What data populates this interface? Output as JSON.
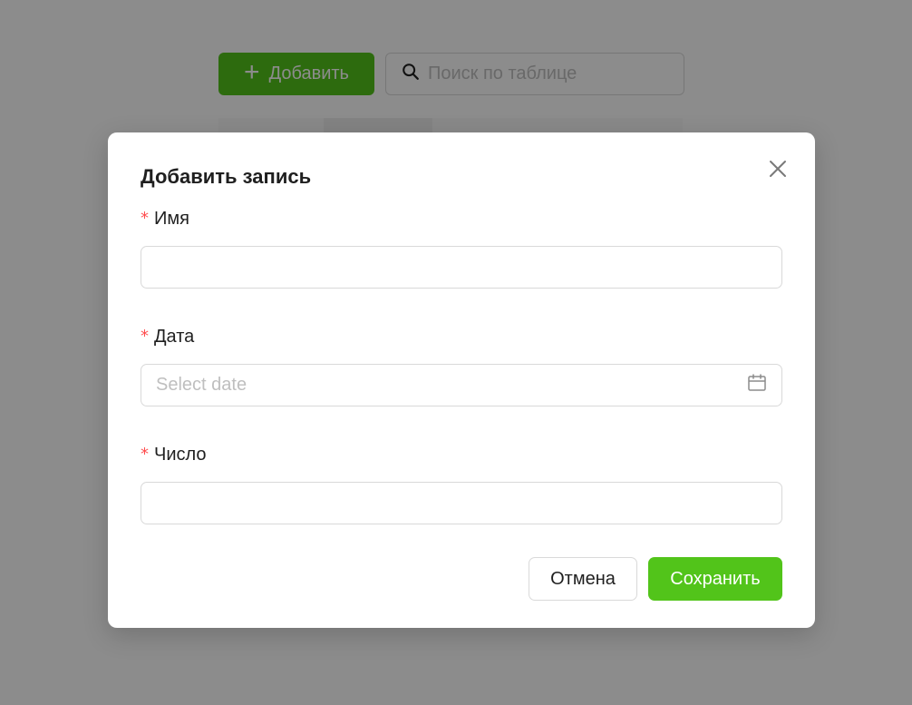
{
  "toolbar": {
    "add_label": "Добавить",
    "search_placeholder": "Поиск по таблице"
  },
  "modal": {
    "title": "Добавить запись",
    "fields": [
      {
        "label": "Имя",
        "required": true,
        "value": "",
        "placeholder": ""
      },
      {
        "label": "Дата",
        "required": true,
        "value": "",
        "placeholder": "Select date"
      },
      {
        "label": "Число",
        "required": true,
        "value": "",
        "placeholder": ""
      }
    ],
    "required_mark": "*",
    "cancel_label": "Отмена",
    "save_label": "Сохранить"
  },
  "icons": {
    "add": "plus-icon",
    "search": "search-icon",
    "close": "close-icon",
    "date": "calendar-icon"
  },
  "colors": {
    "primary": "#52c41a",
    "required": "#ff4d4f",
    "border": "#d9d9d9",
    "placeholder": "#bfbfbf"
  }
}
